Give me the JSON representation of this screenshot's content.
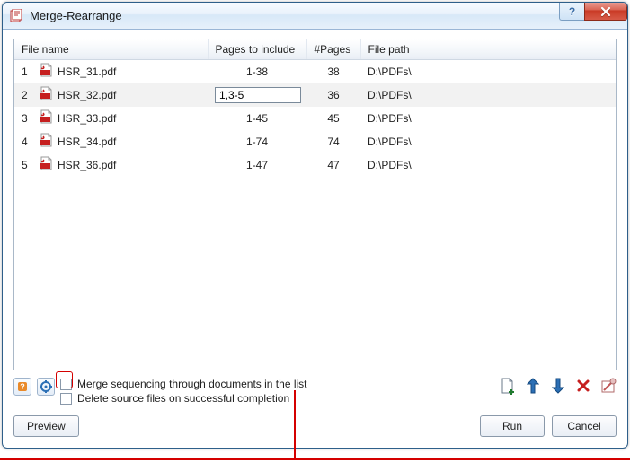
{
  "window": {
    "title": "Merge-Rearrange"
  },
  "columns": {
    "filename": "File name",
    "pages_to_include": "Pages to include",
    "npages": "#Pages",
    "filepath": "File path"
  },
  "rows": [
    {
      "idx": "1",
      "name": "HSR_31.pdf",
      "pages": "1-38",
      "npages": "38",
      "path": "D:\\PDFs\\",
      "editing": false,
      "selected": false
    },
    {
      "idx": "2",
      "name": "HSR_32.pdf",
      "pages": "1,3-5",
      "npages": "36",
      "path": "D:\\PDFs\\",
      "editing": true,
      "selected": true
    },
    {
      "idx": "3",
      "name": "HSR_33.pdf",
      "pages": "1-45",
      "npages": "45",
      "path": "D:\\PDFs\\",
      "editing": false,
      "selected": false
    },
    {
      "idx": "4",
      "name": "HSR_34.pdf",
      "pages": "1-74",
      "npages": "74",
      "path": "D:\\PDFs\\",
      "editing": false,
      "selected": false
    },
    {
      "idx": "5",
      "name": "HSR_36.pdf",
      "pages": "1-47",
      "npages": "47",
      "path": "D:\\PDFs\\",
      "editing": false,
      "selected": false
    }
  ],
  "checks": {
    "merge_seq": "Merge sequencing through documents in the list",
    "delete_src": "Delete source files on successful completion"
  },
  "buttons": {
    "preview": "Preview",
    "run": "Run",
    "cancel": "Cancel"
  },
  "icons": {
    "help": "?",
    "add_file": "add-file-icon",
    "move_up": "arrow-up-icon",
    "move_down": "arrow-down-icon",
    "remove": "remove-icon",
    "clear": "clear-list-icon",
    "help_small": "help-icon",
    "options": "options-gear-icon"
  }
}
